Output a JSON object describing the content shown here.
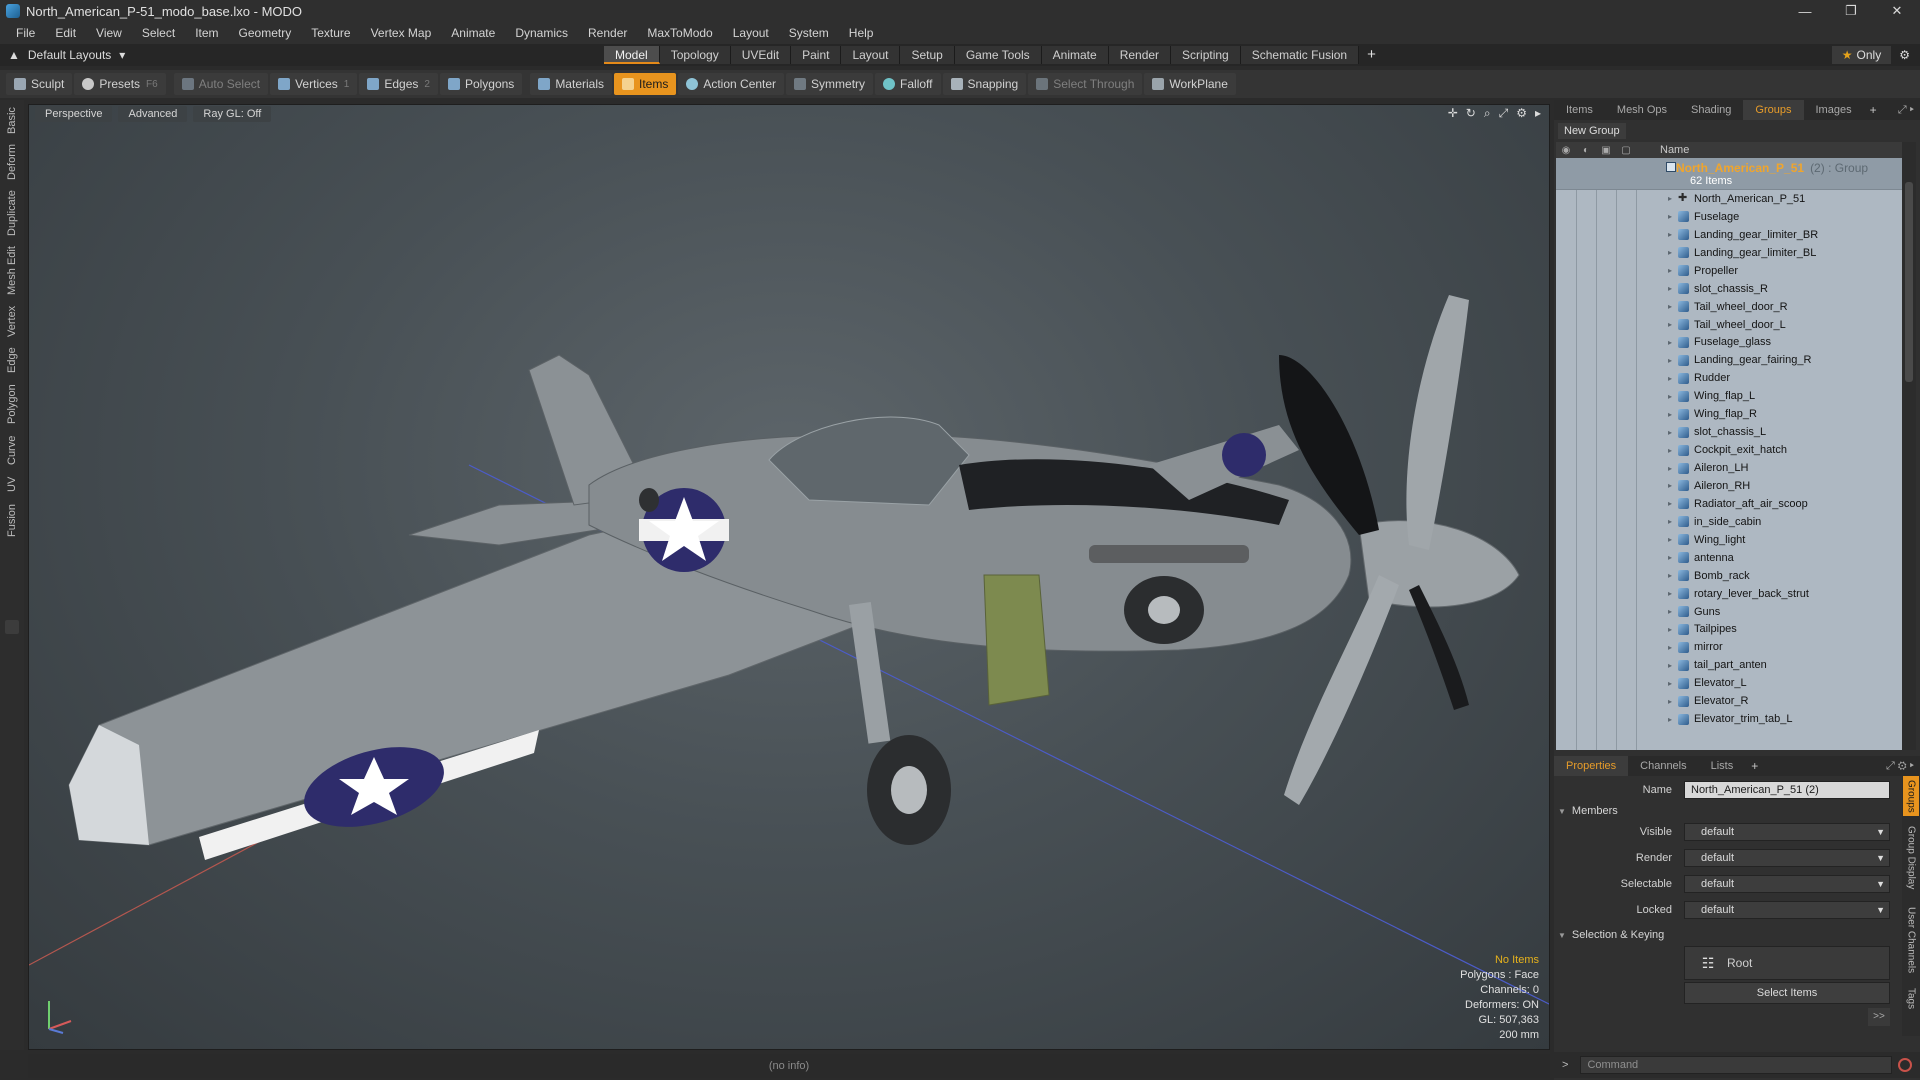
{
  "window": {
    "title": "North_American_P-51_modo_base.lxo - MODO",
    "controls": [
      "—",
      "❐",
      "✕"
    ]
  },
  "menu": [
    "File",
    "Edit",
    "View",
    "Select",
    "Item",
    "Geometry",
    "Texture",
    "Vertex Map",
    "Animate",
    "Dynamics",
    "Render",
    "MaxToModo",
    "Layout",
    "System",
    "Help"
  ],
  "layout_bar": {
    "layout_dropdown": "Default Layouts",
    "tabs": [
      "Model",
      "Topology",
      "UVEdit",
      "Paint",
      "Layout",
      "Setup",
      "Game Tools",
      "Animate",
      "Render",
      "Scripting",
      "Schematic Fusion"
    ],
    "active_tab": "Model",
    "add": "+",
    "only_label": "Only"
  },
  "toolbar": {
    "sculpt": "Sculpt",
    "presets": "Presets",
    "presets_key": "F6",
    "auto_select": "Auto Select",
    "vertices": "Vertices",
    "vertices_count": "1",
    "edges": "Edges",
    "edges_count": "2",
    "polygons": "Polygons",
    "materials": "Materials",
    "items": "Items",
    "action_center": "Action Center",
    "symmetry": "Symmetry",
    "falloff": "Falloff",
    "snapping": "Snapping",
    "select_through": "Select Through",
    "workplane": "WorkPlane"
  },
  "left_tabs": [
    "Basic",
    "Deform",
    "Duplicate",
    "Mesh Edit",
    "Vertex",
    "Edge",
    "Polygon",
    "Curve",
    "UV",
    "Fusion"
  ],
  "viewport": {
    "perspective": "Perspective",
    "advanced": "Advanced",
    "raygl": "Ray GL: Off",
    "info": {
      "selection": "No Items",
      "polygons": "Polygons : Face",
      "channels": "Channels: 0",
      "deformers": "Deformers: ON",
      "gl": "GL: 507,363",
      "scale": "200 mm"
    },
    "roundel_color": "#2e2c6b",
    "metal_color": "#8a9094"
  },
  "statusbar": {
    "text": "(no info)"
  },
  "right_panel": {
    "top_tabs": [
      "Items",
      "Mesh Ops",
      "Shading",
      "Groups",
      "Images"
    ],
    "active_top_tab": "Groups",
    "new_group": "New Group",
    "column_name": "Name",
    "group": {
      "name": "North_American_P_51",
      "count_suffix": "(2) : Group",
      "items_label": "62 Items"
    },
    "items": [
      "North_American_P_51",
      "Fuselage",
      "Landing_gear_limiter_BR",
      "Landing_gear_limiter_BL",
      "Propeller",
      "slot_chassis_R",
      "Tail_wheel_door_R",
      "Tail_wheel_door_L",
      "Fuselage_glass",
      "Landing_gear_fairing_R",
      "Rudder",
      "Wing_flap_L",
      "Wing_flap_R",
      "slot_chassis_L",
      "Cockpit_exit_hatch",
      "Aileron_LH",
      "Aileron_RH",
      "Radiator_aft_air_scoop",
      "in_side_cabin",
      "Wing_light",
      "antenna",
      "Bomb_rack",
      "rotary_lever_back_strut",
      "Guns",
      "Tailpipes",
      "mirror",
      "tail_part_anten",
      "Elevator_L",
      "Elevator_R",
      "Elevator_trim_tab_L"
    ],
    "bottom_tabs": [
      "Properties",
      "Channels",
      "Lists"
    ],
    "active_bottom_tab": "Properties",
    "properties": {
      "name_label": "Name",
      "name_value": "North_American_P_51 (2)",
      "members_section": "Members",
      "visible_label": "Visible",
      "visible_value": "default",
      "render_label": "Render",
      "render_value": "default",
      "selectable_label": "Selectable",
      "selectable_value": "default",
      "locked_label": "Locked",
      "locked_value": "default",
      "selection_section": "Selection & Keying",
      "root_label": "Root",
      "select_items": "Select Items",
      "more": ">>"
    },
    "side_tabs": [
      "Groups",
      "Group Display",
      "User Channels",
      "Tags"
    ],
    "active_side_tab": "Groups",
    "command_placeholder": "Command",
    "command_prompt": ">"
  }
}
